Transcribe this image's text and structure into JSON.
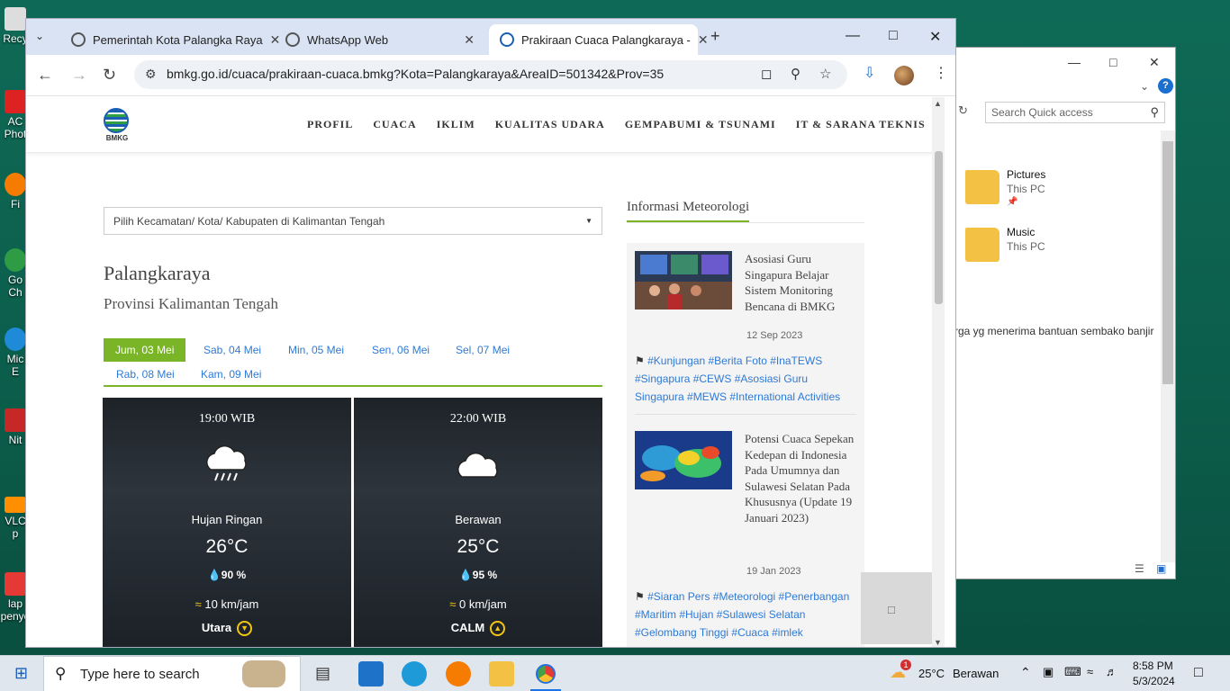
{
  "desktop": {
    "icons": [
      "Recy",
      "AC\nPhot",
      "Fi",
      "Go\nCh",
      "Mic\nE",
      "Nit",
      "VLC\np",
      "lap\npenye"
    ]
  },
  "explorer": {
    "search_placeholder": "Search Quick access",
    "items": [
      {
        "name": "Pictures",
        "location": "This PC"
      },
      {
        "name": "Music",
        "location": "This PC"
      }
    ],
    "fragment_text": "rga yg menerima bantuan sembako banjir"
  },
  "browser": {
    "tabs": [
      {
        "label": "Pemerintah Kota Palangka Raya"
      },
      {
        "label": "WhatsApp Web"
      },
      {
        "label": "Prakiraan Cuaca Palangkaraya -"
      }
    ],
    "url": "bmkg.go.id/cuaca/prakiraan-cuaca.bmkg?Kota=Palangkaraya&AreaID=501342&Prov=35"
  },
  "site": {
    "logo_text": "BMKG",
    "menu": [
      "PROFIL",
      "CUACA",
      "IKLIM",
      "KUALITAS UDARA",
      "GEMPABUMI & TSUNAMI",
      "IT & SARANA TEKNIS"
    ],
    "select_placeholder": "Pilih Kecamatan/ Kota/ Kabupaten di Kalimantan Tengah",
    "city": "Palangkaraya",
    "province": "Provinsi Kalimantan Tengah",
    "days": [
      "Jum, 03 Mei",
      "Sab, 04 Mei",
      "Min, 05 Mei",
      "Sen, 06 Mei",
      "Sel, 07 Mei",
      "Rab, 08 Mei",
      "Kam, 09 Mei"
    ],
    "forecasts": [
      {
        "time": "19:00 WIB",
        "condition": "Hujan Ringan",
        "temp": "26°C",
        "humidity": "90 %",
        "wind": "10 km/jam",
        "direction": "Utara"
      },
      {
        "time": "22:00 WIB",
        "condition": "Berawan",
        "temp": "25°C",
        "humidity": "95 %",
        "wind": "0 km/jam",
        "direction": "CALM"
      }
    ],
    "sidebar": {
      "title": "Informasi Meteorologi",
      "news": [
        {
          "title": "Asosiasi Guru Singapura Belajar Sistem Monitoring Bencana di BMKG",
          "date": "12 Sep 2023",
          "tags": "#Kunjungan #Berita Foto #InaTEWS #Singapura #CEWS #Asosiasi Guru Singapura #MEWS #International Activities"
        },
        {
          "title": "Potensi Cuaca Sepekan Kedepan di Indonesia Pada Umumnya dan Sulawesi Selatan Pada Khususnya (Update 19 Januari 2023)",
          "date": "19 Jan 2023",
          "tags": "#Siaran Pers #Meteorologi #Penerbangan #Maritim #Hujan #Sulawesi Selatan #Gelombang Tinggi #Cuaca #imlek"
        }
      ]
    }
  },
  "taskbar": {
    "search_placeholder": "Type here to search",
    "weather_temp": "25°C",
    "weather_text": "Berawan",
    "weather_badge": "1",
    "time": "8:58 PM",
    "date": "5/3/2024"
  },
  "colors": {
    "accent_green": "#7ab527",
    "link_blue": "#2d7ad6",
    "compass_yellow": "#f2c40f"
  }
}
